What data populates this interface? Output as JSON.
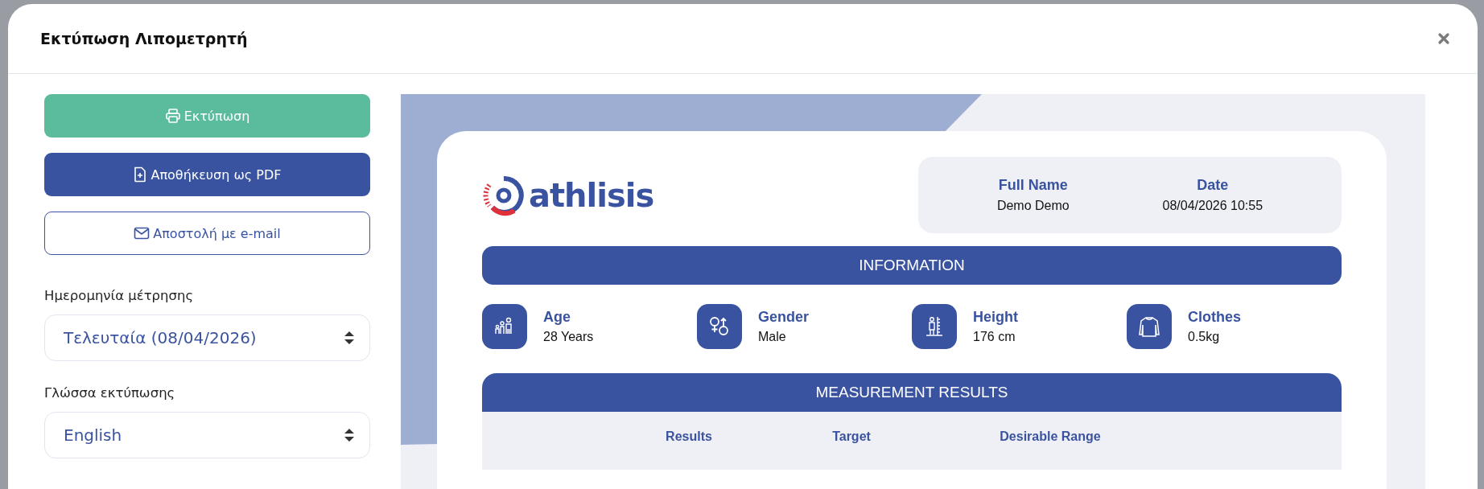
{
  "dialog": {
    "title": "Εκτύπωση Λιπομετρητή"
  },
  "actions": [
    {
      "label": "Εκτύπωση",
      "kind": "print"
    },
    {
      "label": "Αποθήκευση ως PDF",
      "kind": "pdf"
    },
    {
      "label": "Αποστολή με e-mail",
      "kind": "email"
    }
  ],
  "settings": [
    {
      "label": "Ημερομηνία μέτρησης",
      "value": "Τελευταία (08/04/2026)"
    },
    {
      "label": "Γλώσσα εκτύπωσης",
      "value": "English"
    }
  ],
  "preview": {
    "logo": "athlisis",
    "header_fields": [
      {
        "label": "Full Name",
        "value": "Demo Demo"
      },
      {
        "label": "Date",
        "value": "08/04/2026 10:55"
      }
    ],
    "information": {
      "title": "INFORMATION",
      "items": [
        {
          "kind": "age",
          "label": "Age",
          "value": "28 Years"
        },
        {
          "kind": "gender",
          "label": "Gender",
          "value": "Male"
        },
        {
          "kind": "height",
          "label": "Height",
          "value": "176 cm"
        },
        {
          "kind": "clothes",
          "label": "Clothes",
          "value": "0.5kg"
        }
      ]
    },
    "results": {
      "title": "MEASUREMENT RESULTS",
      "columns": [
        "Results",
        "Target",
        "Desirable Range"
      ]
    }
  }
}
